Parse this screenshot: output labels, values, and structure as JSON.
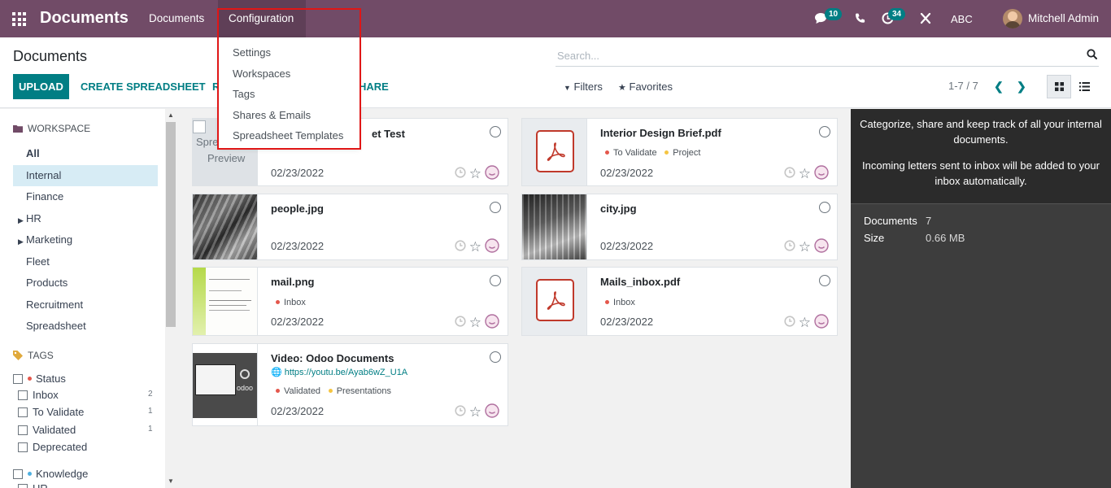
{
  "navbar": {
    "app_title": "Documents",
    "menu_documents": "Documents",
    "menu_configuration": "Configuration",
    "messages_badge": "10",
    "activities_badge": "34",
    "company": "ABC",
    "user": "Mitchell Admin"
  },
  "config_menu": {
    "items": [
      "Settings",
      "Workspaces",
      "Tags",
      "Shares & Emails",
      "Spreadsheet Templates"
    ]
  },
  "control_panel": {
    "title": "Documents",
    "search_placeholder": "Search...",
    "upload_label": "UPLOAD",
    "create_spreadsheet_label": "CREATE SPREADSHEET",
    "request_label_partial": "R",
    "share_label_partial": "HARE",
    "filters_label": "Filters",
    "favorites_label": "Favorites",
    "pager": "1-7 / 7"
  },
  "sidebar": {
    "workspace_title": "WORKSPACE",
    "workspaces": [
      "All",
      "Internal",
      "Finance",
      "HR",
      "Marketing",
      "Fleet",
      "Products",
      "Recruitment",
      "Spreadsheet"
    ],
    "tags_title": "TAGS",
    "status_group": "Status",
    "status_tags": [
      {
        "label": "Inbox",
        "count": "2"
      },
      {
        "label": "To Validate",
        "count": "1"
      },
      {
        "label": "Validated",
        "count": "1"
      },
      {
        "label": "Deprecated",
        "count": ""
      }
    ],
    "knowledge_group": "Knowledge",
    "knowledge_partial": "HR"
  },
  "cards": [
    {
      "name": "et Test",
      "thumb_text_1": "Spre",
      "thumb_text_2": "Preview",
      "date": "02/23/2022"
    },
    {
      "name": "Interior Design Brief.pdf",
      "tags": [
        "To Validate",
        "Project"
      ],
      "date": "02/23/2022"
    },
    {
      "name": "people.jpg",
      "date": "02/23/2022"
    },
    {
      "name": "city.jpg",
      "date": "02/23/2022"
    },
    {
      "name": "mail.png",
      "tags": [
        "Inbox"
      ],
      "date": "02/23/2022"
    },
    {
      "name": "Mails_inbox.pdf",
      "tags": [
        "Inbox"
      ],
      "date": "02/23/2022"
    },
    {
      "name": "Video: Odoo Documents",
      "url": "https://youtu.be/Ayab6wZ_U1A",
      "tags": [
        "Validated",
        "Presentations"
      ],
      "date": "02/23/2022"
    }
  ],
  "inspector": {
    "help_1": "Categorize, share and keep track of all your internal documents.",
    "help_2": "Incoming letters sent to inbox will be added to your inbox automatically.",
    "documents_label": "Documents",
    "documents_value": "7",
    "size_label": "Size",
    "size_value": "0.66 MB"
  },
  "colors": {
    "brand": "#714B67",
    "accent": "#017e84",
    "highlight_border": "#e01616"
  }
}
